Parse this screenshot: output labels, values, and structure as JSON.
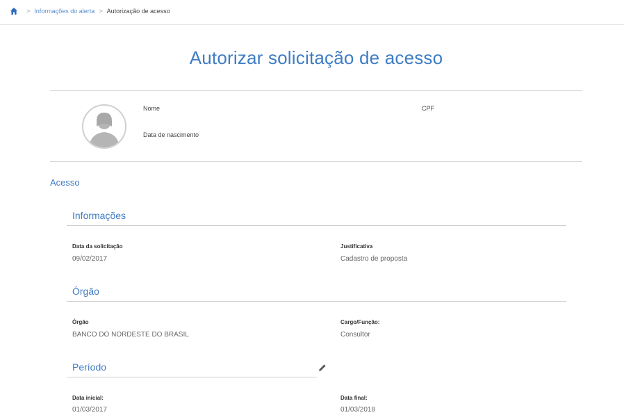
{
  "breadcrumb": {
    "home_icon": "home-icon",
    "items": [
      "Informações do alerta",
      "Autorização de acesso"
    ],
    "separator": ">"
  },
  "page_title": "Autorizar solicitação de acesso",
  "profile": {
    "avatar_icon": "user-avatar-icon",
    "name_label": "Nome",
    "cpf_label": "CPF",
    "birth_label": "Data de nascimento"
  },
  "acesso": {
    "title": "Acesso",
    "informacoes": {
      "title": "Informações",
      "data_solicitacao_label": "Data da solicitação",
      "data_solicitacao_value": "09/02/2017",
      "justificativa_label": "Justificativa",
      "justificativa_value": "Cadastro de proposta"
    },
    "orgao": {
      "title": "Órgão",
      "orgao_label": "Órgão",
      "orgao_value": "BANCO DO NORDESTE DO BRASIL",
      "cargo_label": "Cargo/Função:",
      "cargo_value": "Consultor"
    },
    "periodo": {
      "title": "Período",
      "edit_icon": "pencil-icon",
      "data_inicial_label": "Data inicial:",
      "data_inicial_value": "01/03/2017",
      "data_final_label": "Data final:",
      "data_final_value": "01/03/2018"
    }
  },
  "colors": {
    "accent": "#3f7cc4",
    "link": "#5b8fcf",
    "rule": "#d6d6d6"
  }
}
